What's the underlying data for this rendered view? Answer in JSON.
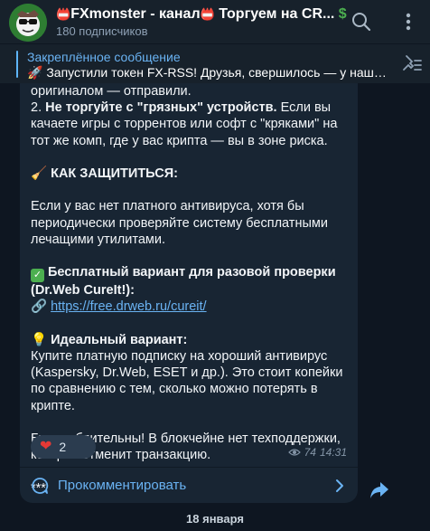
{
  "header": {
    "title_prefix_emoji": "📛",
    "title_name": "FXmonster - канал",
    "title_mid_emoji": "📛",
    "title_tail": "Торгуем на CR...",
    "title_end_emoji": "$",
    "subscribers": "180 подписчиков",
    "search_icon": "search-icon",
    "menu_icon": "more-vertical-icon"
  },
  "pinned": {
    "label": "Закреплённое сообщение",
    "text": "🚀 Запустили токен FX-RSS!  Друзья, свершилось — у нашего...",
    "icon": "pin-list-icon"
  },
  "message": {
    "lines": {
      "l1": "оригиналом — отправили.",
      "l2_prefix": "2.  ",
      "l2_bold": "Не торгуйте с \"грязных\" устройств.",
      "l2_rest": " Если вы качаете игры с торрентов или софт с \"кряками\" на тот же комп, где у вас крипта — вы в зоне риска.",
      "protect_emoji": "🧹",
      "protect_heading": "КАК ЗАЩИТИТЬСЯ:",
      "protect_text": "Если у вас нет платного антивируса, хотя бы периодически проверяйте систему бесплатными лечащими утилитами.",
      "free_emoji": "✓",
      "free_heading": "Бесплатный вариант для разовой проверки (Dr.Web CureIt!):",
      "link_emoji": "🔗",
      "link_text": "https://free.drweb.ru/cureit/",
      "ideal_emoji": "💡",
      "ideal_heading": "Идеальный вариант:",
      "ideal_text": "Купите платную подписку на хороший антивирус (Kaspersky, Dr.Web, ESET и др.). Это стоит копейки по сравнению с тем, сколько можно потерять в крипте.",
      "final_text": "Будьте бдительны! В блокчейне нет техподдержки, которая отменит транзакцию.",
      "stars": "***"
    },
    "reaction": {
      "emoji": "❤",
      "count": "2"
    },
    "views": "74",
    "time": "14:31",
    "comments_label": "Прокомментировать"
  },
  "date_separator": "18 января",
  "colors": {
    "accent": "#6ab3f3",
    "bubble": "#182533",
    "background": "#0e1621",
    "header": "#17212b"
  }
}
